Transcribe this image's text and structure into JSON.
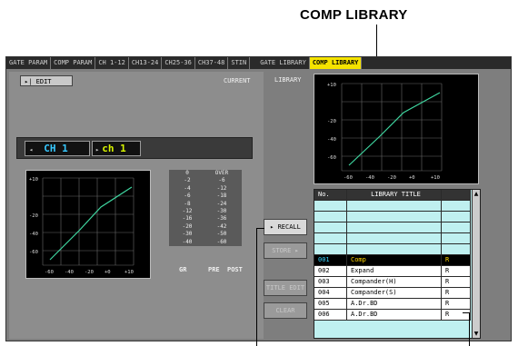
{
  "callout": {
    "title": "COMP LIBRARY"
  },
  "tabs": [
    {
      "label": "GATE PARAM"
    },
    {
      "label": "COMP PARAM"
    },
    {
      "label": "CH 1-12"
    },
    {
      "label": "CH13-24"
    },
    {
      "label": "CH25-36"
    },
    {
      "label": "CH37-48"
    },
    {
      "label": "STIN"
    },
    {
      "label": "GATE LIBRARY"
    },
    {
      "label": "COMP LIBRARY",
      "active": true
    }
  ],
  "left_panel": {
    "edit_label": "▸| EDIT",
    "current_label": "CURRENT",
    "channel_id": "CH 1",
    "channel_name": "ch 1"
  },
  "graph_ticks": {
    "y": [
      "+10",
      "-20",
      "-40",
      "-60"
    ],
    "x": [
      "-60",
      "-40",
      "-20",
      "+0",
      "+10"
    ]
  },
  "meters": {
    "gr_label": "GR",
    "pre_label": "PRE",
    "post_label": "POST",
    "gr_scale": [
      "0",
      "-2",
      "-4",
      "-6",
      "-8",
      "-12",
      "-16",
      "-20",
      "-30",
      "-40"
    ],
    "level_scale": [
      "OVER",
      "-6",
      "-12",
      "-18",
      "-24",
      "-30",
      "-36",
      "-42",
      "-50",
      "-60"
    ]
  },
  "library_label": "LIBRARY",
  "buttons": {
    "recall": "▸ RECALL",
    "store": "STORE ▸",
    "title_edit": "TITLE EDIT",
    "clear": "CLEAR"
  },
  "library": {
    "headers": [
      "No.",
      "LIBRARY TITLE",
      ""
    ],
    "rows": [
      {
        "no": "",
        "title": "",
        "flag": ""
      },
      {
        "no": "",
        "title": "",
        "flag": ""
      },
      {
        "no": "",
        "title": "",
        "flag": ""
      },
      {
        "no": "",
        "title": "",
        "flag": ""
      },
      {
        "no": "",
        "title": "",
        "flag": ""
      },
      {
        "no": "001",
        "title": "Comp",
        "flag": "R",
        "selected": true
      },
      {
        "no": "002",
        "title": "Expand",
        "flag": "R"
      },
      {
        "no": "003",
        "title": "Compander(H)",
        "flag": "R"
      },
      {
        "no": "004",
        "title": "Compander(S)",
        "flag": "R"
      },
      {
        "no": "005",
        "title": "A.Dr.BD",
        "flag": "R"
      },
      {
        "no": "006",
        "title": "A.Dr.BD",
        "flag": "R"
      }
    ]
  },
  "colors": {
    "accent": "#f5e300",
    "selected_row": "#000000",
    "table_bg": "#bff0f0",
    "curve": "#3fd6a0"
  }
}
